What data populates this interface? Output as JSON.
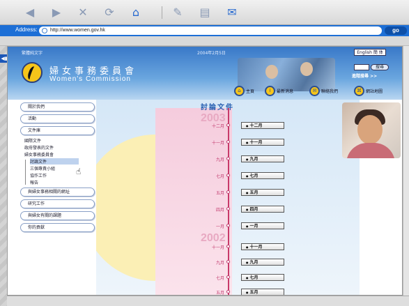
{
  "browser": {
    "address_label": "Address:",
    "url": "http://www.women.gov.hk",
    "go_label": "go"
  },
  "site": {
    "topline": "繁體純文字",
    "date": "2004年2月5日",
    "lang": "English  簡 体",
    "title_zh": "婦女事務委員會",
    "title_en": "Women's Commission",
    "search_btn": "搜尋",
    "advanced_search": "進階搜尋 >>",
    "top_nav": [
      "主頁",
      "最新消息",
      "聯絡我們",
      "網站地圖"
    ]
  },
  "menu": {
    "items": [
      "關於我們",
      "活動",
      "文件庫",
      "與婦女事務相關的網址",
      "研究工作",
      "與婦女有關的課題",
      "你的貢獻"
    ],
    "sub_items": [
      "國際文件",
      "政府發表的文件",
      "婦女事務委員會",
      "討論文件",
      "三個專責小組",
      "協作工作",
      "報告"
    ]
  },
  "content": {
    "heading": "討論文件",
    "year_2003": "2003",
    "year_2002": "2002",
    "months_2003": [
      "十二月",
      "十一月",
      "九月",
      "七月",
      "五月",
      "四月",
      "一月"
    ],
    "months_2002": [
      "十一月",
      "九月",
      "七月",
      "五月"
    ]
  }
}
